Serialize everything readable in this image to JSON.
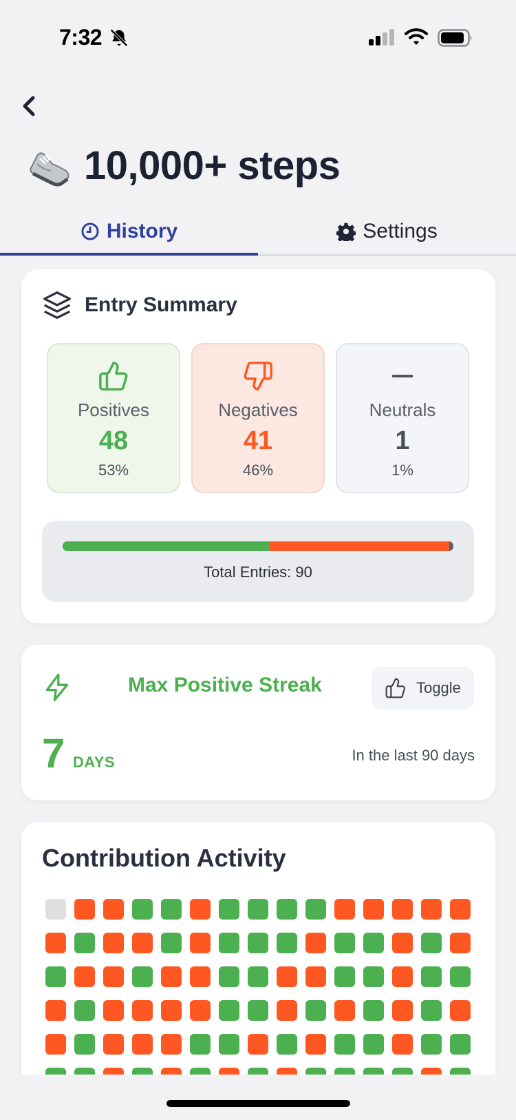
{
  "status_bar": {
    "time": "7:32"
  },
  "header": {
    "title": "10,000+ steps",
    "emoji_icon": "sneaker-icon"
  },
  "tabs": [
    {
      "label": "History",
      "icon": "clock-icon",
      "active": true
    },
    {
      "label": "Settings",
      "icon": "gear-icon",
      "active": false
    }
  ],
  "summary": {
    "title": "Entry Summary",
    "positives": {
      "label": "Positives",
      "count": "48",
      "percent": "53%"
    },
    "negatives": {
      "label": "Negatives",
      "count": "41",
      "percent": "46%"
    },
    "neutrals": {
      "label": "Neutrals",
      "count": "1",
      "percent": "1%"
    },
    "total_label": "Total Entries: 90",
    "bar_fractions": {
      "positive": 0.53,
      "negative": 0.46,
      "neutral": 0.01
    }
  },
  "streak": {
    "title": "Max Positive Streak",
    "toggle_label": "Toggle",
    "value": "7",
    "unit": "DAYS",
    "range": "In the last 90 days"
  },
  "contribution": {
    "title": "Contribution Activity",
    "rows": [
      "xnnppnppppnnnnn",
      "npnnpnpppnppnpn",
      "pnnpnnppnnppnpp",
      "npnnnnppnpnpnpn",
      "npnnnppnpnppnpp",
      "ppnpnpnpnppppnp"
    ]
  },
  "colors": {
    "positive": "#4caf50",
    "negative": "#ff5722",
    "neutral": "#5b5f6a",
    "empty": "#dedede",
    "accent": "#2f3f9e"
  }
}
